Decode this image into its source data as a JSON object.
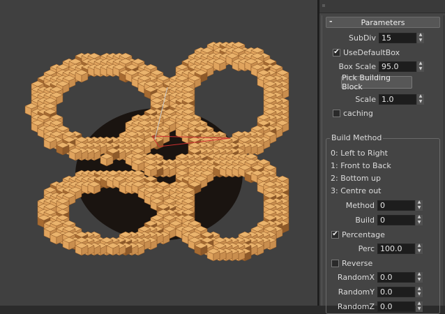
{
  "rollout": {
    "collapse_icon": "-",
    "title": "Parameters"
  },
  "subdiv": {
    "label": "SubDiv",
    "value": "15"
  },
  "use_default_box": {
    "label": "UseDefaultBox",
    "checked": true
  },
  "box_scale": {
    "label": "Box Scale",
    "value": "95.0"
  },
  "pick_building_block": {
    "label": "Pick Building Block"
  },
  "scale": {
    "label": "Scale",
    "value": "1.0"
  },
  "caching": {
    "label": "caching",
    "checked": false
  },
  "build_method": {
    "group_title": "Build Method",
    "options": [
      "0: Left to Right",
      "1: Front to Back",
      "2: Bottom up",
      "3: Centre out"
    ],
    "method": {
      "label": "Method",
      "value": "0"
    },
    "build": {
      "label": "Build",
      "value": "0"
    },
    "percentage": {
      "label": "Percentage",
      "checked": true
    },
    "perc": {
      "label": "Perc",
      "value": "100.0"
    },
    "reverse": {
      "label": "Reverse",
      "checked": false
    },
    "random_x": {
      "label": "RandomX",
      "value": "0.0"
    },
    "random_y": {
      "label": "RandomY",
      "value": "0.0"
    },
    "random_z": {
      "label": "RandomZ",
      "value": "0.0"
    }
  },
  "icons": {
    "spinner_up": "up-arrow-icon",
    "spinner_down": "down-arrow-icon",
    "check": "checkmark-icon"
  },
  "colors": {
    "voxel_face": "#e0a45e",
    "voxel_dark": "#a66b32",
    "viewport_bg": "#404040",
    "panel_bg": "#444444",
    "gizmo_red": "#d03030"
  }
}
